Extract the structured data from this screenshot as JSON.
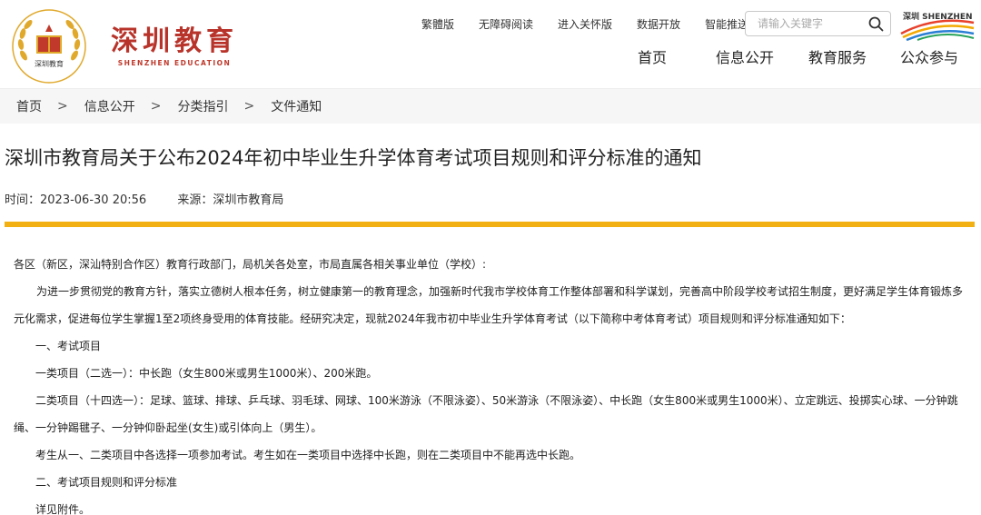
{
  "brand": {
    "name_cn": "深圳教育",
    "name_en": "SHENZHEN EDUCATION",
    "emblem_text": "深圳教育",
    "partner_logo_text": "深圳 SHENZHEN CHINA"
  },
  "top_links": [
    "繁體版",
    "无障碍阅读",
    "进入关怀版",
    "数据开放",
    "智能推送"
  ],
  "search": {
    "placeholder": "请输入关键字",
    "value": ""
  },
  "main_nav": [
    "首页",
    "信息公开",
    "教育服务",
    "公众参与"
  ],
  "breadcrumb": {
    "items": [
      "首页",
      "信息公开",
      "分类指引",
      "文件通知"
    ],
    "separator": ">"
  },
  "article": {
    "title": "深圳市教育局关于公布2024年初中毕业生升学体育考试项目规则和评分标准的通知",
    "time_label": "时间：",
    "time_value": "2023-06-30 20:56",
    "source_label": "来源：",
    "source_value": "深圳市教育局",
    "paragraphs": [
      "各区（新区，深汕特别合作区）教育行政部门，局机关各处室，市局直属各相关事业单位（学校）:",
      "为进一步贯彻党的教育方针，落实立德树人根本任务，树立健康第一的教育理念，加强新时代我市学校体育工作整体部署和科学谋划，完善高中阶段学校考试招生制度，更好满足学生体育锻炼多元化需求，促进每位学生掌握1至2项终身受用的体育技能。经研究决定，现就2024年我市初中毕业生升学体育考试（以下简称中考体育考试）项目规则和评分标准通知如下：",
      "一、考试项目",
      "一类项目（二选一）：中长跑（女生800米或男生1000米）、200米跑。",
      "二类项目（十四选一）：足球、篮球、排球、乒乓球、羽毛球、网球、100米游泳（不限泳姿）、50米游泳（不限泳姿）、中长跑（女生800米或男生1000米）、立定跳远、投掷实心球、一分钟跳绳、一分钟踢毽子、一分钟仰卧起坐(女生)或引体向上（男生）。",
      "考生从一、二类项目中各选择一项参加考试。考生如在一类项目中选择中长跑，则在二类项目中不能再选中长跑。",
      "二、考试项目规则和评分标准",
      "详见附件。"
    ]
  },
  "colors": {
    "brand_red": "#b8342b",
    "divider_gold": "#f3b012",
    "breadcrumb_bg": "#f6f6f6"
  }
}
